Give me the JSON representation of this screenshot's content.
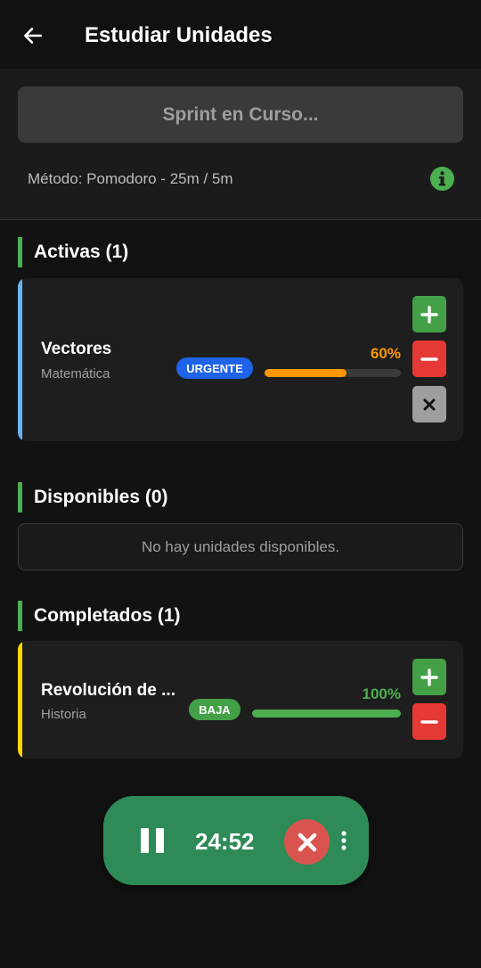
{
  "appbar": {
    "title": "Estudiar Unidades"
  },
  "sprint": {
    "button_label": "Sprint en Curso...",
    "method": "Método: Pomodoro - 25m / 5m"
  },
  "sections": {
    "active": {
      "title": "Activas (1)"
    },
    "available": {
      "title": "Disponibles (0)",
      "empty_message": "No hay unidades disponibles."
    },
    "completed": {
      "title": "Completados (1)"
    }
  },
  "active_units": [
    {
      "name": "Vectores",
      "subject": "Matemática",
      "priority": "URGENTE",
      "progress_label": "60%",
      "progress": 0.6,
      "accent_color": "#64b5f6",
      "priority_color": "#1e63e9",
      "progress_color": "#ff9800"
    }
  ],
  "completed_units": [
    {
      "name": "Revolución de ...",
      "subject": "Historia",
      "priority": "BAJA",
      "progress_label": "100%",
      "progress": 1.0,
      "accent_color": "#ffd600",
      "priority_color": "#43a047",
      "progress_color": "#4caf50"
    }
  ],
  "timer": {
    "time": "24:52"
  },
  "colors": {
    "accent_green": "#4caf50",
    "timer_bg": "#2e8b57",
    "stop_red": "#d9534f"
  },
  "icons": {
    "back": "arrow-left-icon",
    "info": "info-circle-icon",
    "add": "plus-icon",
    "remove": "minus-icon",
    "close": "x-icon",
    "pause": "pause-icon",
    "stop": "x-icon",
    "more": "more-vertical-icon"
  }
}
